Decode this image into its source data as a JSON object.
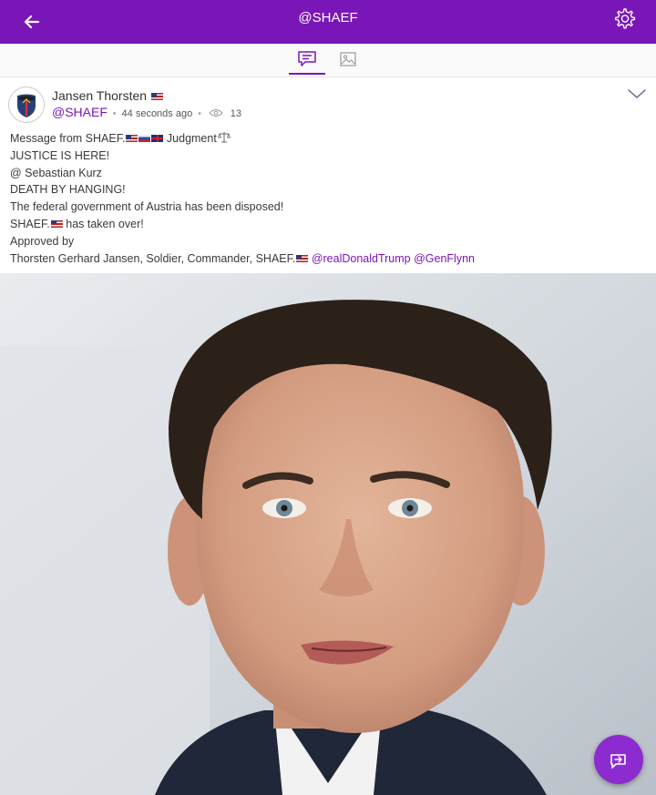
{
  "topbar": {
    "title": "@SHAEF",
    "back_icon": "arrow-left-icon",
    "settings_icon": "gear-icon",
    "color": "#7a16b8"
  },
  "tabs": [
    {
      "icon": "message-icon",
      "active": true
    },
    {
      "icon": "image-icon",
      "active": false
    }
  ],
  "post": {
    "author": "Jansen Thorsten",
    "handle": "@SHAEF",
    "time": "44 seconds ago",
    "views": "13",
    "lines": {
      "l1a": "Message from SHAEF.",
      "l1b": " Judgment",
      "l2": "JUSTICE IS HERE!",
      "l3": "@ Sebastian Kurz",
      "l4": "DEATH BY HANGING!",
      "l5": "The federal government of Austria has been disposed!",
      "l6a": "SHAEF.",
      "l6b": " has taken over!",
      "l7": "Approved by",
      "l8a": "Thorsten Gerhard Jansen, Soldier, Commander, SHAEF.",
      "mention1": "@realDonaldTrump",
      "mention2": "@GenFlynn"
    }
  },
  "fab_icon": "repost-icon"
}
